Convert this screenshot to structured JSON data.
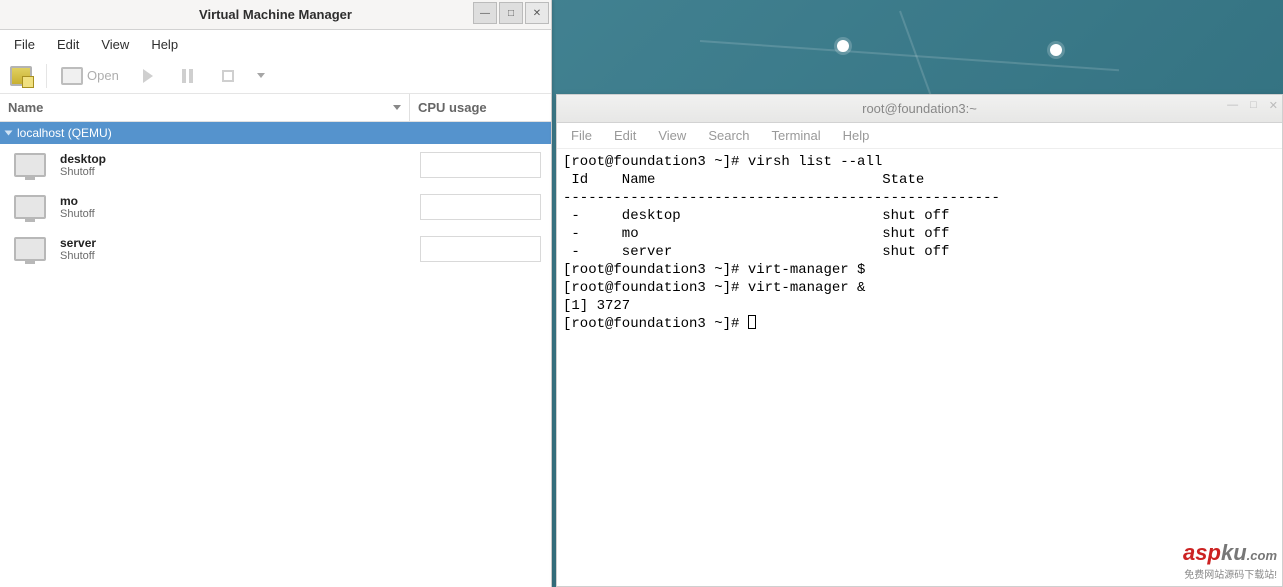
{
  "vmm": {
    "window_title": "Virtual Machine Manager",
    "menubar": [
      "File",
      "Edit",
      "View",
      "Help"
    ],
    "toolbar": {
      "open_label": "Open"
    },
    "columns": {
      "name": "Name",
      "cpu": "CPU usage"
    },
    "host": "localhost (QEMU)",
    "vms": [
      {
        "name": "desktop",
        "state": "Shutoff"
      },
      {
        "name": "mo",
        "state": "Shutoff"
      },
      {
        "name": "server",
        "state": "Shutoff"
      }
    ]
  },
  "terminal": {
    "window_title": "root@foundation3:~",
    "menubar": [
      "File",
      "Edit",
      "View",
      "Search",
      "Terminal",
      "Help"
    ],
    "lines": [
      "[root@foundation3 ~]# virsh list --all",
      " Id    Name                           State",
      "----------------------------------------------------",
      " -     desktop                        shut off",
      " -     mo                             shut off",
      " -     server                         shut off",
      "",
      "[root@foundation3 ~]# virt-manager $",
      "[root@foundation3 ~]# virt-manager &",
      "[1] 3727",
      "[root@foundation3 ~]# "
    ]
  },
  "watermark": {
    "brand_a": "asp",
    "brand_b": "ku",
    "dotcom": ".com",
    "tagline": "免费网站源码下载站!"
  }
}
